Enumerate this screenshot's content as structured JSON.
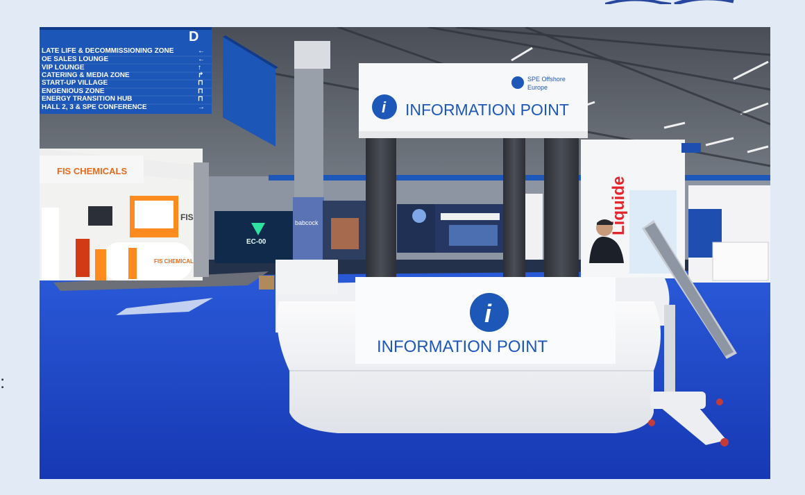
{
  "photo": {
    "alt": "Information Point booth at SPE Offshore Europe exhibition hall"
  },
  "signboard": {
    "items": [
      {
        "label": "LATE LIFE & DECOMMISSIONING ZONE",
        "arrow": "←"
      },
      {
        "label": "OE SALES LOUNGE",
        "arrow": "←"
      },
      {
        "label": "VIP LOUNGE",
        "arrow": "↑"
      },
      {
        "label": "CATERING & MEDIA ZONE",
        "arrow": "↱"
      },
      {
        "label": "START-UP VILLAGE",
        "arrow": "⊓"
      },
      {
        "label": "ENGENIOUS ZONE",
        "arrow": "⊓"
      },
      {
        "label": "ENERGY TRANSITION HUB",
        "arrow": "⊓"
      },
      {
        "label": "HALL 2, 3 & SPE CONFERENCE",
        "arrow": "→"
      }
    ],
    "letter": "D"
  },
  "booth": {
    "header_title": "INFORMATION POINT",
    "front_title": "INFORMATION POINT",
    "info_glyph": "i",
    "sponsor_line1": "SPE Offshore",
    "sponsor_line2": "Europe"
  },
  "exhibitors": {
    "chemicals": "FIS CHEMICALS",
    "fis": "FIS",
    "liquide": "Liquide",
    "babcock": "babcock",
    "ec": "EC-00"
  },
  "colors": {
    "carpet": "#1f47c8",
    "sign_blue": "#1d57b8",
    "booth_white": "#f4f5f7",
    "frame": "#e2eaf6"
  }
}
